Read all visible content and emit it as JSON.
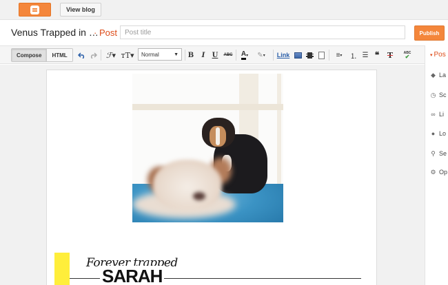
{
  "topbar": {
    "logo_icon": "blogger-logo-icon",
    "view_blog_label": "View blog"
  },
  "title_row": {
    "blog_title": "Venus Trapped in …",
    "separator": "·",
    "post_label": "Post",
    "post_title_placeholder": "Post title",
    "publish_label": "Publish"
  },
  "toolbar": {
    "compose_label": "Compose",
    "html_label": "HTML",
    "undo_icon": "undo-icon",
    "redo_icon": "redo-icon",
    "font_icon": "font-icon",
    "font_size_icon": "font-size-icon",
    "format_value": "Normal",
    "bold_label": "B",
    "italic_label": "I",
    "underline_label": "U",
    "strike_label": "ABC",
    "text_color_label": "A",
    "link_label": "Link",
    "align_icon": "align-icon",
    "numbered_list_icon": "numbered-list-icon",
    "bullet_list_icon": "bullet-list-icon",
    "quote_label": "❝",
    "clear_format_label": "T",
    "spellcheck_label": "ABC"
  },
  "sidebar": {
    "head": "Pos",
    "items": [
      {
        "label": "La",
        "icon": "label-icon"
      },
      {
        "label": "Sc",
        "icon": "clock-icon"
      },
      {
        "label": "Li",
        "icon": "link-icon"
      },
      {
        "label": "Lo",
        "icon": "location-icon"
      },
      {
        "label": "Se",
        "icon": "search-icon"
      },
      {
        "label": "Op",
        "icon": "gear-icon"
      }
    ]
  },
  "content": {
    "header_script": "Forever trapped",
    "header_name": "SARAH"
  },
  "colors": {
    "brand_orange": "#f4863b",
    "post_orange": "#dd4b18",
    "link_blue": "#2a5ea8",
    "yellow_accent": "#ffee3b"
  }
}
